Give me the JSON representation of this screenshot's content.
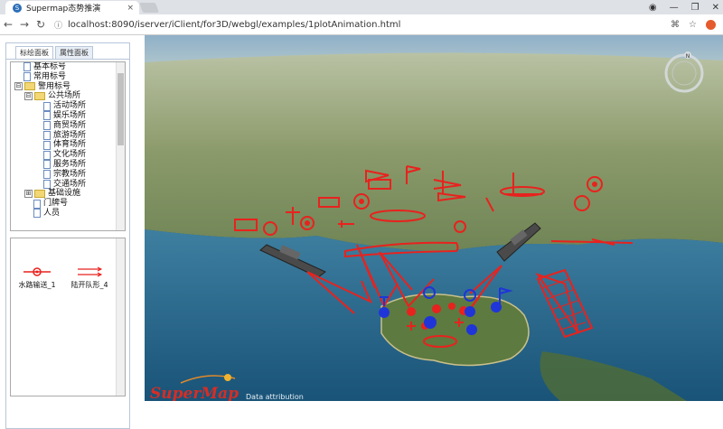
{
  "browser": {
    "tab_title": "Supermap态势推演",
    "tab_close": "×",
    "url": "localhost:8090/iserver/iClient/for3D/webgl/examples/1plotAnimation.html",
    "back_icon": "arrow-left-icon",
    "forward_icon": "arrow-right-icon",
    "reload_icon": "reload-icon",
    "info_icon": "info-icon",
    "window_buttons": [
      "—",
      "❐",
      "✕"
    ]
  },
  "panel": {
    "tabs": [
      "标绘面板",
      "属性面板"
    ],
    "tree": [
      {
        "label": "基本标号",
        "level": 0,
        "kind": "doc"
      },
      {
        "label": "常用标号",
        "level": 0,
        "kind": "doc"
      },
      {
        "label": "警用标号",
        "level": 0,
        "kind": "folder",
        "expander": "⊟"
      },
      {
        "label": "公共场所",
        "level": 1,
        "kind": "folder",
        "expander": "⊟"
      },
      {
        "label": "活动场所",
        "level": 2,
        "kind": "doc"
      },
      {
        "label": "娱乐场所",
        "level": 2,
        "kind": "doc"
      },
      {
        "label": "商贸场所",
        "level": 2,
        "kind": "doc"
      },
      {
        "label": "旅游场所",
        "level": 2,
        "kind": "doc"
      },
      {
        "label": "体育场所",
        "level": 2,
        "kind": "doc"
      },
      {
        "label": "文化场所",
        "level": 2,
        "kind": "doc"
      },
      {
        "label": "服务场所",
        "level": 2,
        "kind": "doc"
      },
      {
        "label": "宗教场所",
        "level": 2,
        "kind": "doc"
      },
      {
        "label": "交通场所",
        "level": 2,
        "kind": "doc"
      },
      {
        "label": "基础设施",
        "level": 1,
        "kind": "folder",
        "expander": "⊞"
      },
      {
        "label": "门牌号",
        "level": 1,
        "kind": "doc"
      },
      {
        "label": "人员",
        "level": 1,
        "kind": "doc"
      }
    ],
    "symbols": [
      {
        "label": "水路输送_1",
        "icon": "waterway-transport-icon"
      },
      {
        "label": "陆开队形_4",
        "icon": "land-formation-icon"
      }
    ]
  },
  "map": {
    "brand": "SuperMap",
    "attribution": "Data attribution",
    "compass_letter": "N",
    "colors": {
      "plot_red": "#e8221e",
      "plot_blue": "#1f35d8",
      "sea": "#1a5a85"
    }
  }
}
